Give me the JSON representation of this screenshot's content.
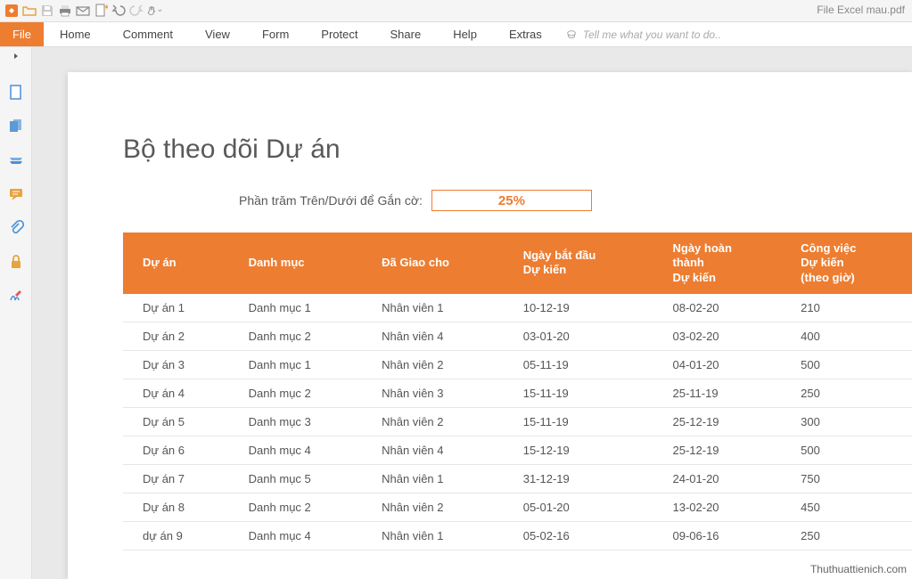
{
  "window": {
    "title": "File Excel mau.pdf"
  },
  "qat": {
    "icons": [
      "app",
      "open",
      "save",
      "print",
      "print-settings",
      "scan",
      "undo",
      "redo",
      "hand"
    ]
  },
  "ribbon": {
    "file": "File",
    "tabs": [
      "Home",
      "Comment",
      "View",
      "Form",
      "Protect",
      "Share",
      "Help",
      "Extras"
    ],
    "tellme": "Tell me what you want to do.."
  },
  "sidebar": {
    "items": [
      "page",
      "multipage",
      "layers",
      "comment",
      "attachment",
      "security",
      "signature"
    ]
  },
  "document": {
    "heading": "Bộ theo dõi Dự án",
    "pct_label": "Phần trăm Trên/Dưới để Gắn cờ:",
    "pct_value": "25%",
    "columns": [
      "Dự án",
      "Danh mục",
      "Đã Giao cho",
      "Ngày bắt đầu Dự kiến",
      "Ngày hoàn thành\nDự kiến",
      "Công việc Dự kiến (theo giờ)"
    ],
    "rows": [
      {
        "p": "Dự án 1",
        "c": "Danh mục 1",
        "a": "Nhân viên 1",
        "s": "10-12-19",
        "e": "08-02-20",
        "h": "210"
      },
      {
        "p": "Dự án 2",
        "c": "Danh mục 2",
        "a": "Nhân viên 4",
        "s": "03-01-20",
        "e": "03-02-20",
        "h": "400"
      },
      {
        "p": "Dự án 3",
        "c": "Danh mục 1",
        "a": "Nhân viên 2",
        "s": "05-11-19",
        "e": "04-01-20",
        "h": "500"
      },
      {
        "p": "Dự án 4",
        "c": "Danh mục 2",
        "a": "Nhân viên 3",
        "s": "15-11-19",
        "e": "25-11-19",
        "h": "250"
      },
      {
        "p": "Dự án 5",
        "c": "Danh mục 3",
        "a": "Nhân viên 2",
        "s": "15-11-19",
        "e": "25-12-19",
        "h": "300"
      },
      {
        "p": "Dự án 6",
        "c": "Danh mục 4",
        "a": "Nhân viên 4",
        "s": "15-12-19",
        "e": "25-12-19",
        "h": "500"
      },
      {
        "p": "Dự án 7",
        "c": "Danh mục 5",
        "a": "Nhân viên 1",
        "s": "31-12-19",
        "e": "24-01-20",
        "h": "750"
      },
      {
        "p": "Dự án 8",
        "c": "Danh mục 2",
        "a": "Nhân viên 2",
        "s": "05-01-20",
        "e": "13-02-20",
        "h": "450"
      },
      {
        "p": "dự án 9",
        "c": "Danh mục 4",
        "a": "Nhân viên 1",
        "s": "05-02-16",
        "e": "09-06-16",
        "h": "250"
      }
    ]
  },
  "watermark": "Thuthuattienich.com"
}
